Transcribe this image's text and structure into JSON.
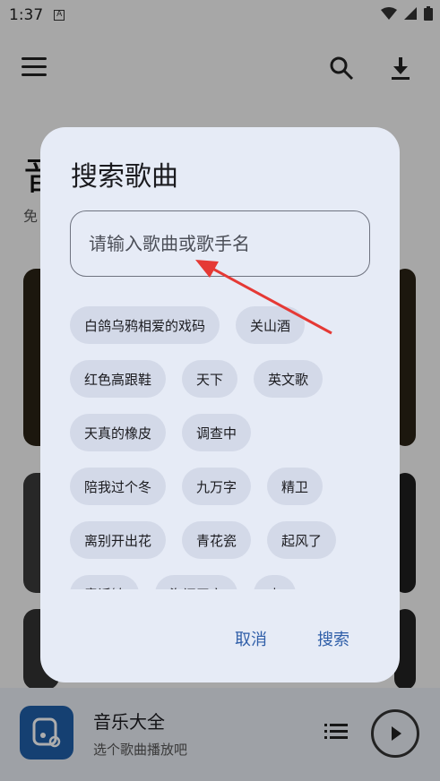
{
  "status_bar": {
    "time": "1:37",
    "badge": "A"
  },
  "background": {
    "title": "音",
    "subtitle": "免",
    "miniplayer": {
      "title": "音乐大全",
      "subtitle": "选个歌曲播放吧"
    }
  },
  "dialog": {
    "title": "搜索歌曲",
    "search_placeholder": "请输入歌曲或歌手名",
    "chip_rows": [
      [
        "白鸽乌鸦相爱的戏码",
        "关山酒"
      ],
      [
        "红色高跟鞋",
        "天下",
        "英文歌"
      ],
      [
        "天真的橡皮",
        "调查中"
      ],
      [
        "陪我过个冬",
        "九万字",
        "精卫"
      ],
      [
        "离别开出花",
        "青花瓷",
        "起风了"
      ],
      [
        "童话镇",
        "海阔天空",
        "点"
      ]
    ],
    "cancel_label": "取消",
    "search_label": "搜索"
  },
  "colors": {
    "accent": "#2f5ea8",
    "dialog_bg": "#e6ebf6",
    "chip_bg": "#d3d9e8",
    "arrow": "#e53935"
  },
  "icons": [
    "menu-icon",
    "search-icon",
    "download-icon",
    "wifi-icon",
    "signal-icon",
    "battery-icon",
    "queue-icon",
    "play-icon",
    "music-note-icon"
  ]
}
